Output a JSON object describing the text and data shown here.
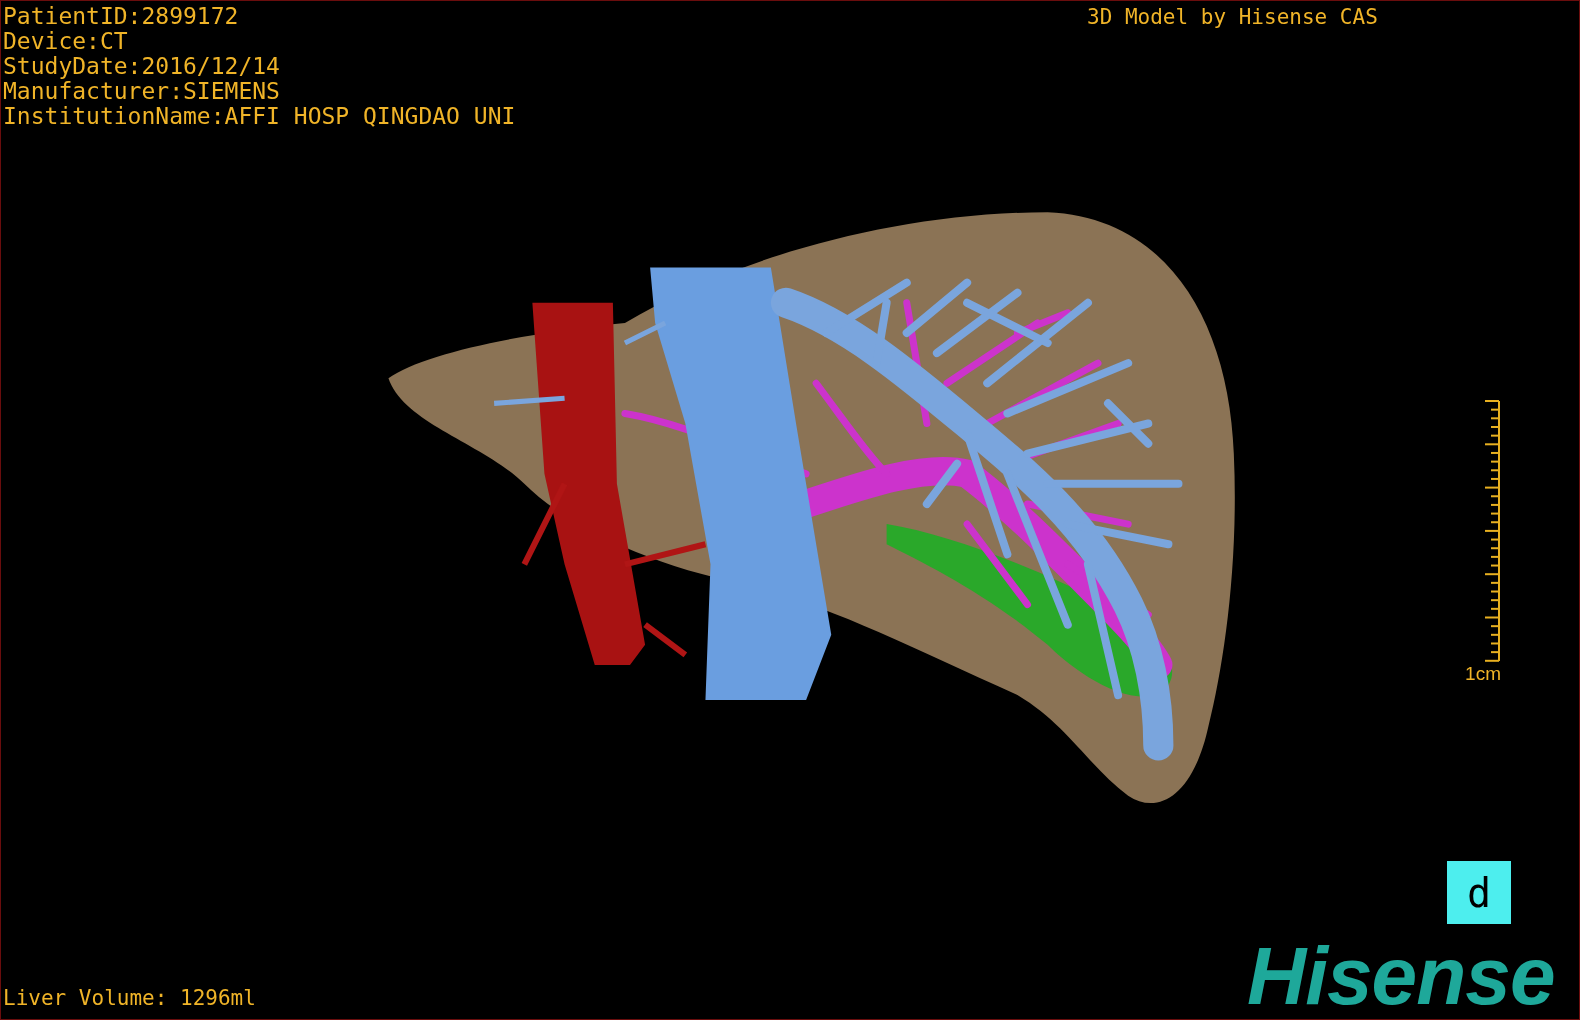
{
  "viewport": {
    "patient_info": [
      "PatientID:2899172",
      "Device:CT",
      "StudyDate:2016/12/14",
      "Manufacturer:SIEMENS",
      "InstitutionName:AFFI HOSP QINGDAO UNI"
    ],
    "title": "3D Model by Hisense CAS",
    "scale_bar": {
      "label": "1cm"
    },
    "view_button": {
      "label": "d"
    },
    "liver_volume": "Liver Volume: 1296ml",
    "logo": "Hisense"
  }
}
